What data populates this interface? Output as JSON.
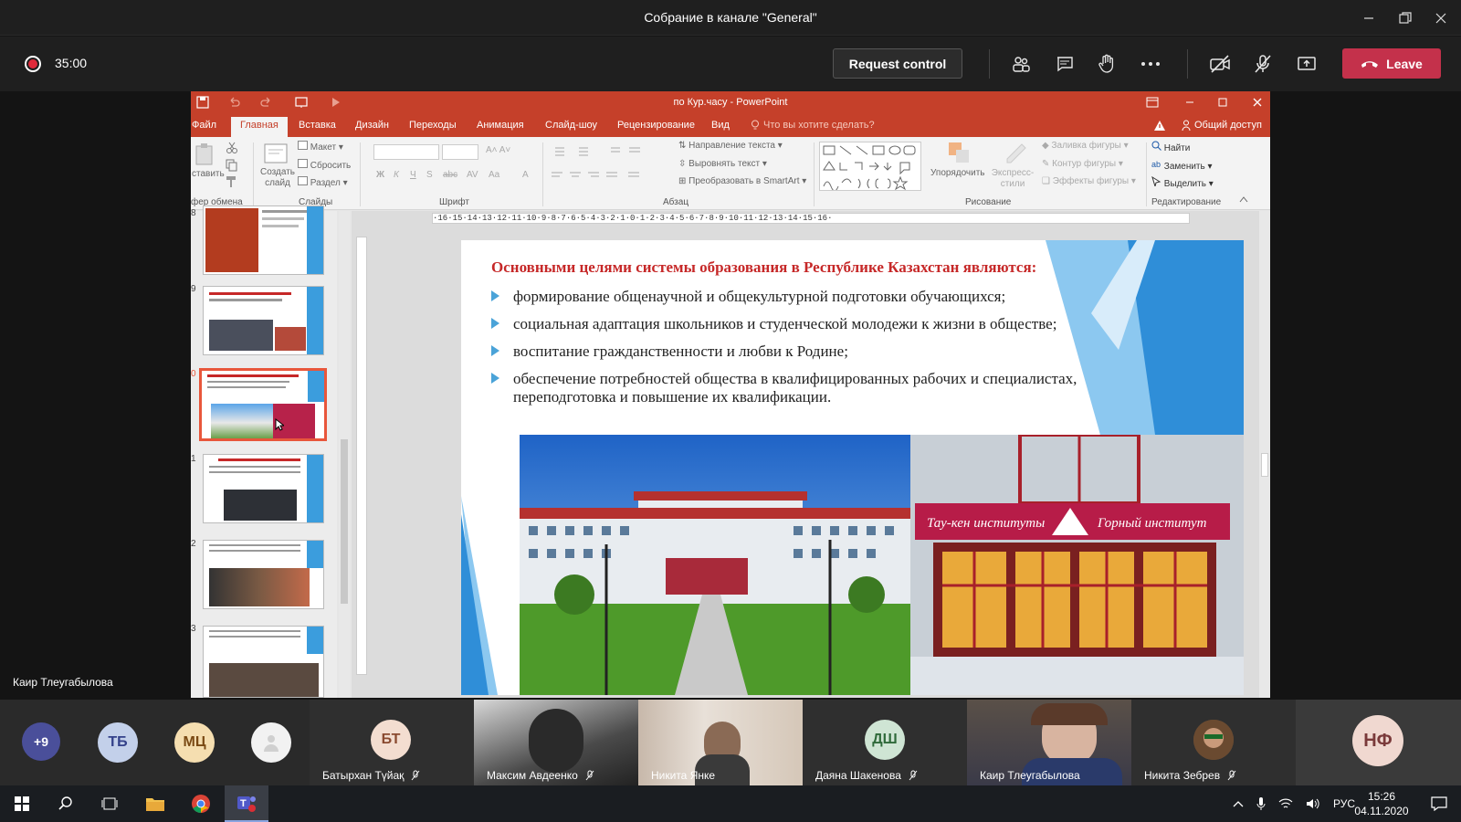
{
  "window": {
    "title": "Собрание в канале \"General\""
  },
  "meeting": {
    "timer": "35:00",
    "request_control": "Request control",
    "leave": "Leave"
  },
  "powerpoint": {
    "title": "по Кур.часу - PowerPoint",
    "tabs": [
      "Файл",
      "Главная",
      "Вставка",
      "Дизайн",
      "Переходы",
      "Анимация",
      "Слайд-шоу",
      "Рецензирование",
      "Вид"
    ],
    "tell_me": "Что вы хотите сделать?",
    "share": "Общий доступ",
    "ribbon": {
      "paste": "ставить",
      "clipboard": "фер обмена",
      "create_slide": "Создать слайд",
      "layout": "Макет",
      "reset": "Сбросить",
      "section": "Раздел",
      "slides": "Слайды",
      "font": "Шрифт",
      "text_direction": "Направление текста",
      "align_text": "Выровнять текст",
      "smartart": "Преобразовать в SmartArt",
      "paragraph": "Абзац",
      "arrange": "Упорядочить",
      "quick_styles": "Экспресс-стили",
      "shape_fill": "Заливка фигуры",
      "shape_outline": "Контур фигуры",
      "shape_effects": "Эффекты фигуры",
      "drawing": "Рисование",
      "find": "Найти",
      "replace": "Заменить",
      "select": "Выделить",
      "editing": "Редактирование"
    },
    "thumb_numbers": [
      "8",
      "9",
      "0",
      "1",
      "2",
      "3"
    ],
    "ruler": "·16·15·14·13·12·11·10·9·8·7·6·5·4·3·2·1·0·1·2·3·4·5·6·7·8·9·10·11·12·13·14·15·16·"
  },
  "slide": {
    "heading": "Основными целями системы образования в Республике Казахстан являются:",
    "bullets": [
      "формирование общенаучной и общекультурной подготовки обучающихся;",
      "социальная адаптация школьников и студенческой молодежи к жизни в обществе;",
      "воспитание гражданственности и любви к Родине;",
      "обеспечение потребностей общества в квалифицированных рабочих и специалистах,",
      "переподготовка и повышение их квалификации."
    ],
    "sign_left": "Тау-кен институты",
    "sign_right": "Горный институт"
  },
  "speaker": "Каир Тлеугабылова",
  "participants": {
    "overflow": "+9",
    "avatars": [
      "ТБ",
      "МЦ"
    ],
    "tiles": [
      {
        "initials": "БТ",
        "name": "Батырхан Түйақ"
      },
      {
        "name": "Максим Авдеенко"
      },
      {
        "name": "Никита Янке"
      },
      {
        "initials": "ДШ",
        "name": "Даяна Шакенова"
      },
      {
        "name": "Каир Тлеугабылова"
      },
      {
        "name": "Никита Зебрев"
      },
      {
        "initials": "НФ"
      }
    ]
  },
  "taskbar": {
    "lang": "РУС",
    "time": "15:26",
    "date": "04.11.2020"
  }
}
